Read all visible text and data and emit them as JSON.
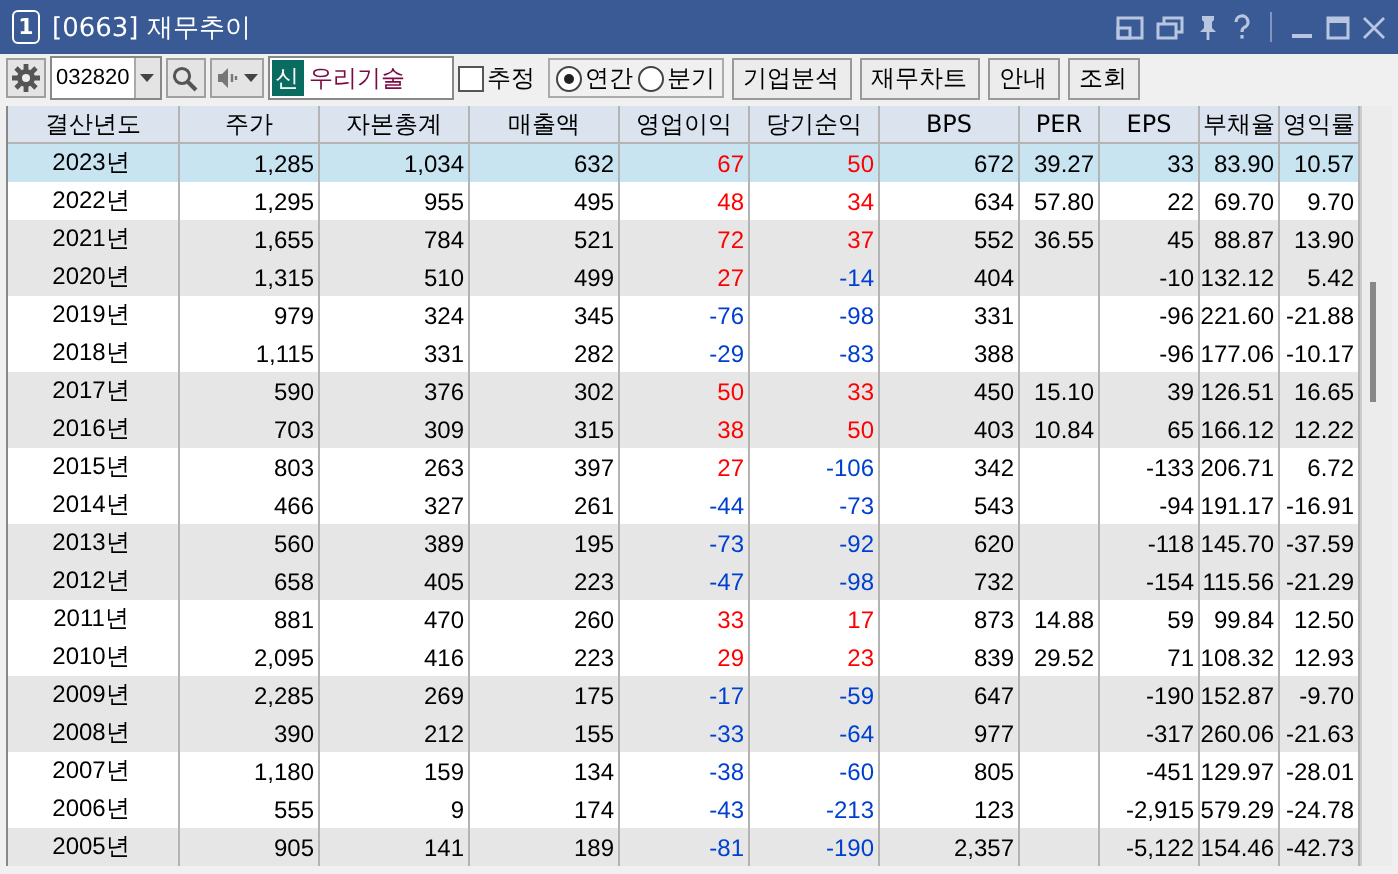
{
  "window": {
    "badge": "1",
    "title": "[0663] 재무추이"
  },
  "toolbar": {
    "code": "032820",
    "market_badge": "신",
    "stock_name": "우리기술",
    "estimate": {
      "label": "추정",
      "checked": false
    },
    "period": [
      {
        "label": "연간",
        "selected": true
      },
      {
        "label": "분기",
        "selected": false
      }
    ],
    "buttons": [
      "기업분석",
      "재무차트",
      "안내",
      "조회"
    ]
  },
  "table": {
    "columns": [
      "결산년도",
      "주가",
      "자본총계",
      "매출액",
      "영업이익",
      "당기순익",
      "BPS",
      "PER",
      "EPS",
      "부채율",
      "영익률"
    ],
    "rows": [
      {
        "selected": true,
        "cells": [
          "2023년",
          "1,285",
          "1,034",
          "632",
          {
            "text": "67",
            "color": "#ff0000"
          },
          {
            "text": "50",
            "color": "#ff0000"
          },
          "672",
          "39.27",
          "33",
          "83.90",
          "10.57"
        ]
      },
      {
        "selected": false,
        "cells": [
          "2022년",
          "1,295",
          "955",
          "495",
          {
            "text": "48",
            "color": "#ff0000"
          },
          {
            "text": "34",
            "color": "#ff0000"
          },
          "634",
          "57.80",
          "22",
          "69.70",
          "9.70"
        ]
      },
      {
        "selected": false,
        "cells": [
          "2021년",
          "1,655",
          "784",
          "521",
          {
            "text": "72",
            "color": "#ff0000"
          },
          {
            "text": "37",
            "color": "#ff0000"
          },
          "552",
          "36.55",
          "45",
          "88.87",
          "13.90"
        ]
      },
      {
        "selected": false,
        "cells": [
          "2020년",
          "1,315",
          "510",
          "499",
          {
            "text": "27",
            "color": "#ff0000"
          },
          {
            "text": "-14",
            "color": "#0040d0"
          },
          "404",
          "",
          "-10",
          "132.12",
          "5.42"
        ]
      },
      {
        "selected": false,
        "cells": [
          "2019년",
          "979",
          "324",
          "345",
          {
            "text": "-76",
            "color": "#0040d0"
          },
          {
            "text": "-98",
            "color": "#0040d0"
          },
          "331",
          "",
          "-96",
          "221.60",
          "-21.88"
        ]
      },
      {
        "selected": false,
        "cells": [
          "2018년",
          "1,115",
          "331",
          "282",
          {
            "text": "-29",
            "color": "#0040d0"
          },
          {
            "text": "-83",
            "color": "#0040d0"
          },
          "388",
          "",
          "-96",
          "177.06",
          "-10.17"
        ]
      },
      {
        "selected": false,
        "cells": [
          "2017년",
          "590",
          "376",
          "302",
          {
            "text": "50",
            "color": "#ff0000"
          },
          {
            "text": "33",
            "color": "#ff0000"
          },
          "450",
          "15.10",
          "39",
          "126.51",
          "16.65"
        ]
      },
      {
        "selected": false,
        "cells": [
          "2016년",
          "703",
          "309",
          "315",
          {
            "text": "38",
            "color": "#ff0000"
          },
          {
            "text": "50",
            "color": "#ff0000"
          },
          "403",
          "10.84",
          "65",
          "166.12",
          "12.22"
        ]
      },
      {
        "selected": false,
        "cells": [
          "2015년",
          "803",
          "263",
          "397",
          {
            "text": "27",
            "color": "#ff0000"
          },
          {
            "text": "-106",
            "color": "#0040d0"
          },
          "342",
          "",
          "-133",
          "206.71",
          "6.72"
        ]
      },
      {
        "selected": false,
        "cells": [
          "2014년",
          "466",
          "327",
          "261",
          {
            "text": "-44",
            "color": "#0040d0"
          },
          {
            "text": "-73",
            "color": "#0040d0"
          },
          "543",
          "",
          "-94",
          "191.17",
          "-16.91"
        ]
      },
      {
        "selected": false,
        "cells": [
          "2013년",
          "560",
          "389",
          "195",
          {
            "text": "-73",
            "color": "#0040d0"
          },
          {
            "text": "-92",
            "color": "#0040d0"
          },
          "620",
          "",
          "-118",
          "145.70",
          "-37.59"
        ]
      },
      {
        "selected": false,
        "cells": [
          "2012년",
          "658",
          "405",
          "223",
          {
            "text": "-47",
            "color": "#0040d0"
          },
          {
            "text": "-98",
            "color": "#0040d0"
          },
          "732",
          "",
          "-154",
          "115.56",
          "-21.29"
        ]
      },
      {
        "selected": false,
        "cells": [
          "2011년",
          "881",
          "470",
          "260",
          {
            "text": "33",
            "color": "#ff0000"
          },
          {
            "text": "17",
            "color": "#ff0000"
          },
          "873",
          "14.88",
          "59",
          "99.84",
          "12.50"
        ]
      },
      {
        "selected": false,
        "cells": [
          "2010년",
          "2,095",
          "416",
          "223",
          {
            "text": "29",
            "color": "#ff0000"
          },
          {
            "text": "23",
            "color": "#ff0000"
          },
          "839",
          "29.52",
          "71",
          "108.32",
          "12.93"
        ]
      },
      {
        "selected": false,
        "cells": [
          "2009년",
          "2,285",
          "269",
          "175",
          {
            "text": "-17",
            "color": "#0040d0"
          },
          {
            "text": "-59",
            "color": "#0040d0"
          },
          "647",
          "",
          "-190",
          "152.87",
          "-9.70"
        ]
      },
      {
        "selected": false,
        "cells": [
          "2008년",
          "390",
          "212",
          "155",
          {
            "text": "-33",
            "color": "#0040d0"
          },
          {
            "text": "-64",
            "color": "#0040d0"
          },
          "977",
          "",
          "-317",
          "260.06",
          "-21.63"
        ]
      },
      {
        "selected": false,
        "cells": [
          "2007년",
          "1,180",
          "159",
          "134",
          {
            "text": "-38",
            "color": "#0040d0"
          },
          {
            "text": "-60",
            "color": "#0040d0"
          },
          "805",
          "",
          "-451",
          "129.97",
          "-28.01"
        ]
      },
      {
        "selected": false,
        "cells": [
          "2006년",
          "555",
          "9",
          "174",
          {
            "text": "-43",
            "color": "#0040d0"
          },
          {
            "text": "-213",
            "color": "#0040d0"
          },
          "123",
          "",
          "-2,915",
          "579.29",
          "-24.78"
        ]
      },
      {
        "selected": false,
        "cells": [
          "2005년",
          "905",
          "141",
          "189",
          {
            "text": "-81",
            "color": "#0040d0"
          },
          {
            "text": "-190",
            "color": "#0040d0"
          },
          "2,357",
          "",
          "-5,122",
          "154.46",
          "-42.73"
        ]
      }
    ]
  }
}
